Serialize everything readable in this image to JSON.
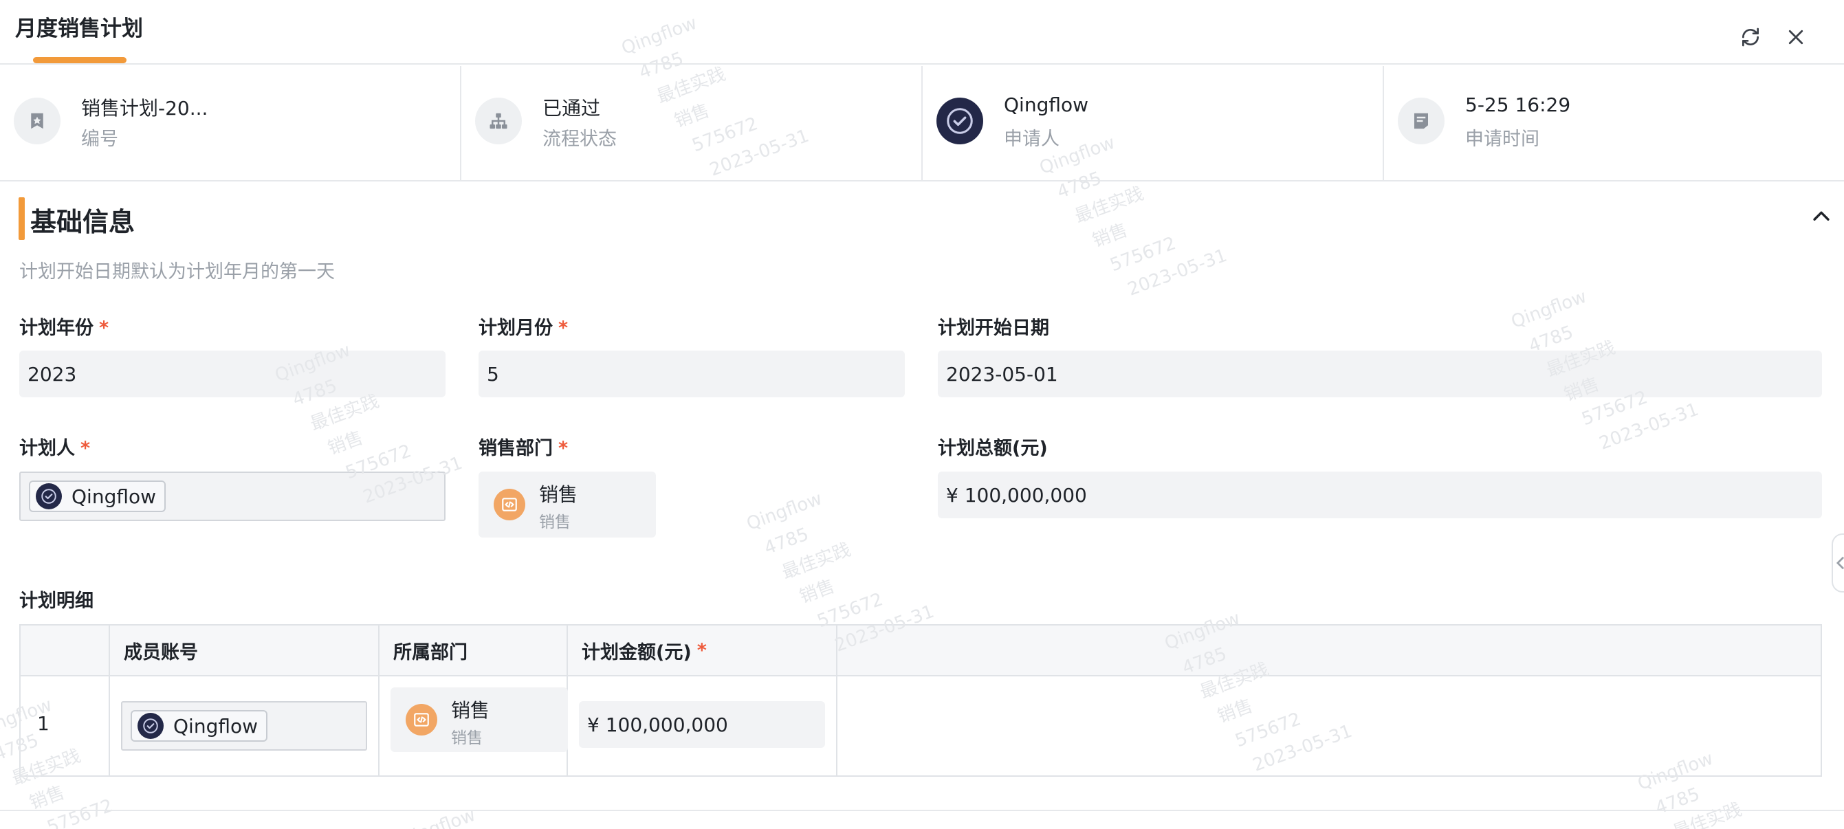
{
  "header": {
    "title": "月度销售计划",
    "refresh_icon": "refresh-icon",
    "close_icon": "close-icon",
    "accent": "#f29a3a"
  },
  "info": [
    {
      "value": "销售计划-20...",
      "label": "编号",
      "icon": "bookmark-icon"
    },
    {
      "value": "已通过",
      "label": "流程状态",
      "icon": "flow-tree-icon"
    },
    {
      "value": "Qingflow",
      "label": "申请人",
      "icon": "avatar-icon"
    },
    {
      "value": "5-25 16:29",
      "label": "申请时间",
      "icon": "document-icon"
    }
  ],
  "section": {
    "title": "基础信息",
    "description": "计划开始日期默认为计划年月的第一天",
    "collapse_icon": "chevron-up-icon"
  },
  "fields": {
    "year": {
      "label": "计划年份",
      "required": "*",
      "value": "2023"
    },
    "month": {
      "label": "计划月份",
      "required": "*",
      "value": "5"
    },
    "start_date": {
      "label": "计划开始日期",
      "value": "2023-05-01"
    },
    "planner": {
      "label": "计划人",
      "required": "*",
      "value": "Qingflow"
    },
    "department": {
      "label": "销售部门",
      "required": "*",
      "name": "销售",
      "sub": "销售"
    },
    "total": {
      "label": "计划总额(元)",
      "value": "¥ 100,000,000"
    }
  },
  "table": {
    "title": "计划明细",
    "columns": [
      "",
      "成员账号",
      "所属部门",
      "计划金额(元)"
    ],
    "required_mark": "*",
    "rows": [
      {
        "index": "1",
        "member": "Qingflow",
        "dept_name": "销售",
        "dept_sub": "销售",
        "amount": "¥ 100,000,000"
      }
    ]
  },
  "watermark": [
    "Qingflow",
    "4785",
    "最佳实践",
    "销售",
    "575672",
    "2023-05-31"
  ]
}
